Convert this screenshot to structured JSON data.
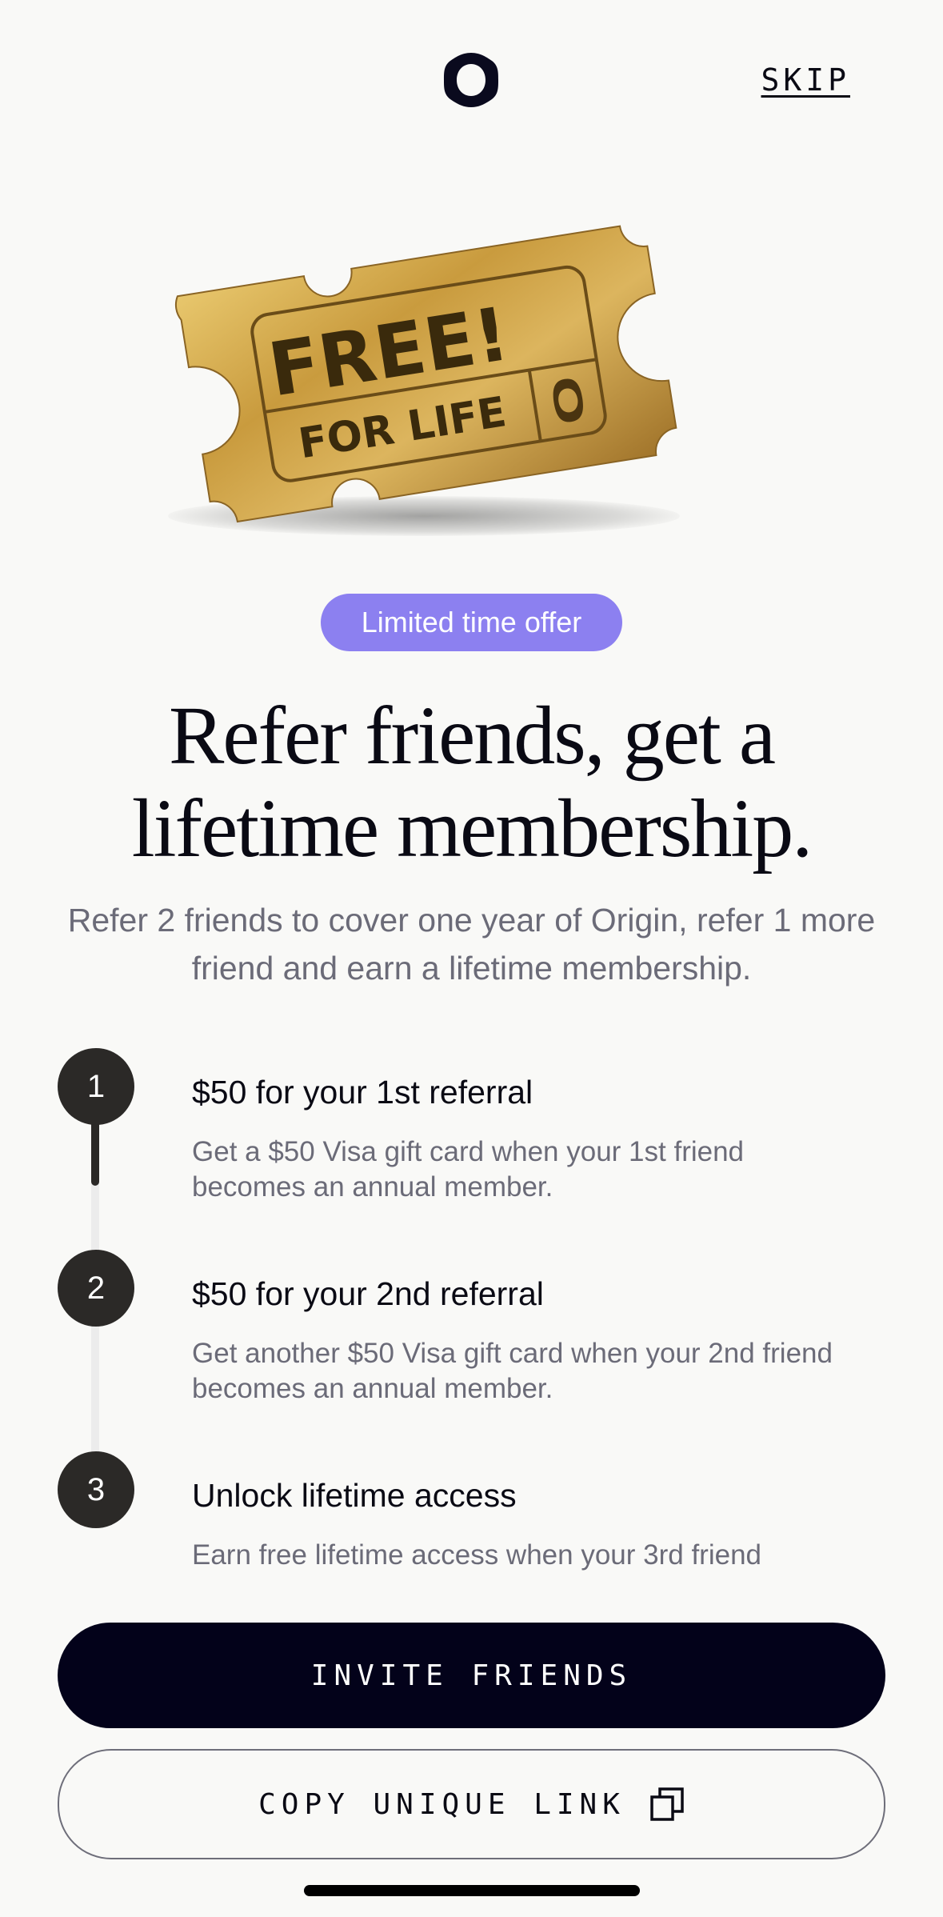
{
  "header": {
    "logo_icon": "origin-logo-icon",
    "skip_label": "SKIP"
  },
  "hero": {
    "ticket_line1": "FREE!",
    "ticket_line2": "FOR LIFE",
    "ticket_color": "#c9a04a"
  },
  "badge": {
    "label": "Limited time offer",
    "color": "#8c80f0"
  },
  "headline": {
    "line1": "Refer friends, get a",
    "line2": "lifetime membership."
  },
  "subtitle": "Refer 2 friends to cover one year of Origin, refer 1 more friend and earn a lifetime membership.",
  "steps": [
    {
      "number": "1",
      "title": "$50 for your 1st referral",
      "description": "Get a $50 Visa gift card when your 1st friend becomes an annual member."
    },
    {
      "number": "2",
      "title": "$50 for your 2nd referral",
      "description": "Get another $50 Visa gift card when your 2nd friend becomes an annual member."
    },
    {
      "number": "3",
      "title": "Unlock lifetime access",
      "description": "Earn free lifetime access when your 3rd friend"
    }
  ],
  "actions": {
    "invite_label": "INVITE FRIENDS",
    "copy_label": "COPY UNIQUE LINK",
    "copy_icon": "copy-icon"
  }
}
